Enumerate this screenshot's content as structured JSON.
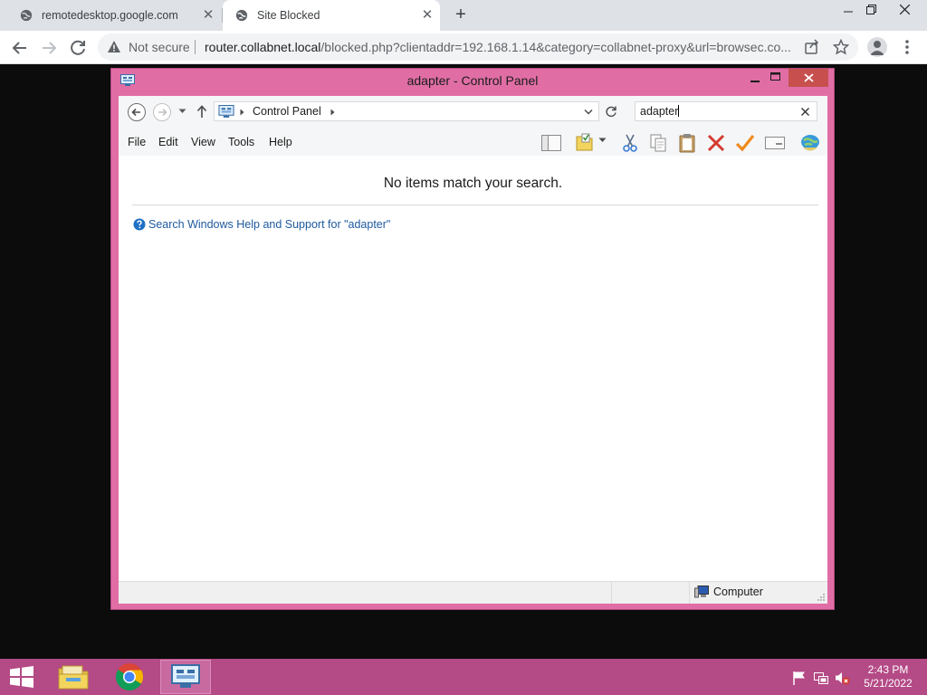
{
  "browser": {
    "tabs": [
      {
        "title": "remotedesktop.google.com",
        "icon": "globe-icon",
        "active": false
      },
      {
        "title": "Site Blocked",
        "icon": "globe-icon",
        "active": true
      }
    ],
    "new_tab_label": "+",
    "close_label": "✕",
    "security_text": "Not secure",
    "url_host": "router.collabnet.local",
    "url_rest": "/blocked.php?clientaddr=192.168.1.14&category=collabnet-proxy&url=browsec.co..."
  },
  "control_panel": {
    "title": "adapter - Control Panel",
    "breadcrumb": "Control Panel",
    "search_value": "adapter",
    "menu": [
      "File",
      "Edit",
      "View",
      "Tools",
      "Help"
    ],
    "empty_message": "No items match your search.",
    "help_link": "Search Windows Help and Support for \"adapter\"",
    "status_location": "Computer"
  },
  "taskbar": {
    "time": "2:43 PM",
    "date": "5/21/2022"
  },
  "colors": {
    "window_frame": "#e06ea5",
    "taskbar": "#b44a86",
    "link": "#1e5aa0",
    "close_button": "#c7504f"
  }
}
